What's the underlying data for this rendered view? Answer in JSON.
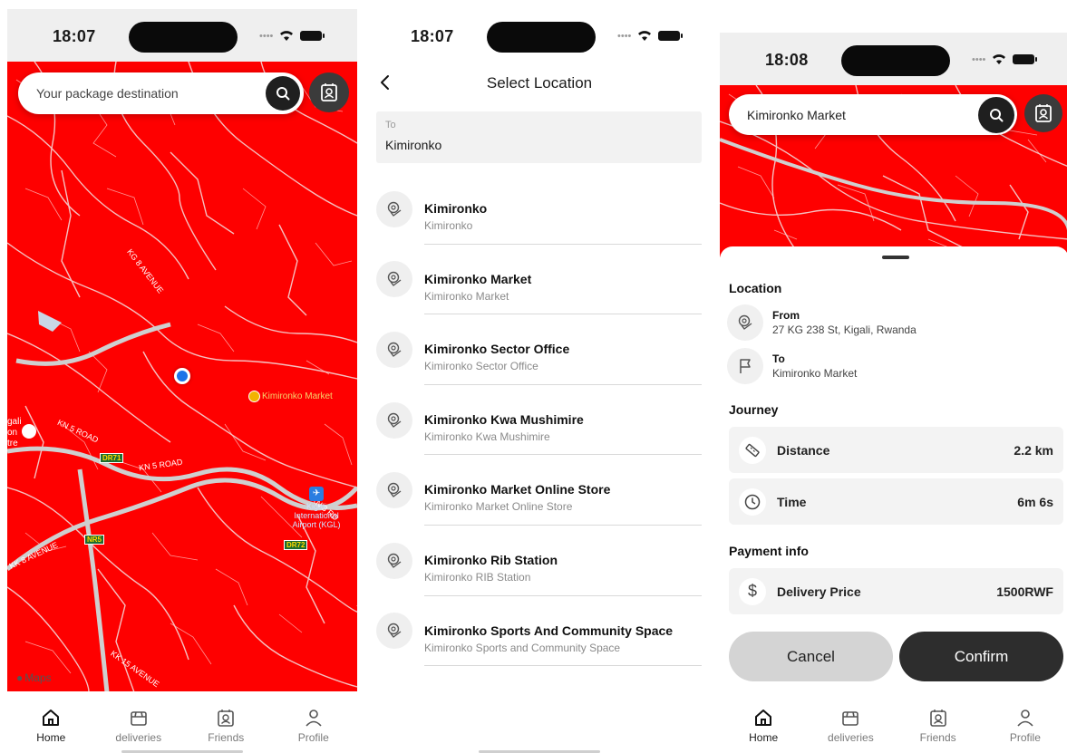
{
  "screens": {
    "home": {
      "status_time": "18:07",
      "search": {
        "placeholder": "Your package destination"
      },
      "map": {
        "labels": {
          "kg_avenue": "KG 8 AVENUE",
          "kn5_road_a": "KN 5 ROAD",
          "kn5_road_b": "KN 5 ROAD",
          "market": "Kimironko Market",
          "airport_line1": "Kigali",
          "airport_line2": "International",
          "airport_line3": "Airport (KGL)",
          "dr71": "DR71",
          "dr72": "DR72",
          "nr5": "NR5",
          "kigali_edge_1": "gali",
          "kigali_edge_2": "on",
          "kigali_edge_3": "tre",
          "maps_attribution": "Maps",
          "kk_avenue": "KK 8 AVENUE",
          "kk_avenue_b": "KK 15 AVENUE",
          "ke": "KN 3 RD"
        }
      },
      "tabbar": [
        {
          "label": "Home",
          "icon": "home-icon",
          "active": true
        },
        {
          "label": "deliveries",
          "icon": "box-icon",
          "active": false
        },
        {
          "label": "Friends",
          "icon": "contact-icon",
          "active": false
        },
        {
          "label": "Profile",
          "icon": "person-icon",
          "active": false
        }
      ]
    },
    "select_location": {
      "status_time": "18:07",
      "title": "Select Location",
      "to_label": "To",
      "to_value": "Kimironko",
      "results": [
        {
          "title": "Kimironko",
          "subtitle": "Kimironko"
        },
        {
          "title": "Kimironko Market",
          "subtitle": "Kimironko Market"
        },
        {
          "title": "Kimironko Sector Office",
          "subtitle": "Kimironko Sector Office"
        },
        {
          "title": "Kimironko Kwa Mushimire",
          "subtitle": "Kimironko Kwa Mushimire"
        },
        {
          "title": "Kimironko Market Online Store",
          "subtitle": "Kimironko Market Online Store"
        },
        {
          "title": "Kimironko Rib Station",
          "subtitle": "Kimironko RIB Station"
        },
        {
          "title": "Kimironko Sports And Community Space",
          "subtitle": "Kimironko Sports and Community Space"
        }
      ]
    },
    "confirm": {
      "status_time": "18:08",
      "search": {
        "value": "Kimironko Market"
      },
      "location_title": "Location",
      "from_label": "From",
      "from_value": "27 KG 238 St, Kigali, Rwanda",
      "to_label": "To",
      "to_value": "Kimironko Market",
      "journey_title": "Journey",
      "distance_label": "Distance",
      "distance_value": "2.2 km",
      "time_label": "Time",
      "time_value": "6m 6s",
      "payment_title": "Payment info",
      "price_label": "Delivery Price",
      "price_value": "1500RWF",
      "cancel_label": "Cancel",
      "confirm_label": "Confirm",
      "tabbar": [
        {
          "label": "Home",
          "icon": "home-icon",
          "active": true
        },
        {
          "label": "deliveries",
          "icon": "box-icon",
          "active": false
        },
        {
          "label": "Friends",
          "icon": "contact-icon",
          "active": false
        },
        {
          "label": "Profile",
          "icon": "person-icon",
          "active": false
        }
      ]
    }
  },
  "colors": {
    "map_red": "#fe0000",
    "road_grey": "#d0d0d0",
    "dark_button": "#2d2d2d",
    "location_dot": "#1e73e8"
  }
}
